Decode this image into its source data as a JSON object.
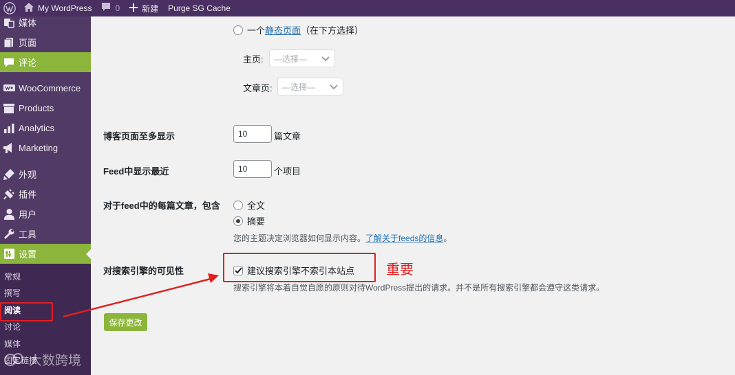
{
  "adminbar": {
    "site_name": "My WordPress",
    "comments_count": "0",
    "new_label": "新建",
    "purge_label": "Purge SG Cache"
  },
  "sidebar": {
    "items": [
      {
        "label": "媒体",
        "icon": "media-icon",
        "state": "normal"
      },
      {
        "label": "页面",
        "icon": "page-icon",
        "state": "normal"
      },
      {
        "label": "评论",
        "icon": "comment-icon",
        "state": "highlight"
      },
      {
        "label": "WooCommerce",
        "icon": "woo-icon",
        "state": "normal"
      },
      {
        "label": "Products",
        "icon": "products-icon",
        "state": "normal"
      },
      {
        "label": "Analytics",
        "icon": "analytics-icon",
        "state": "normal"
      },
      {
        "label": "Marketing",
        "icon": "marketing-icon",
        "state": "normal"
      },
      {
        "label": "外观",
        "icon": "appearance-icon",
        "state": "normal"
      },
      {
        "label": "插件",
        "icon": "plugins-icon",
        "state": "normal"
      },
      {
        "label": "用户",
        "icon": "users-icon",
        "state": "normal"
      },
      {
        "label": "工具",
        "icon": "tools-icon",
        "state": "normal"
      },
      {
        "label": "设置",
        "icon": "settings-icon",
        "state": "current"
      }
    ],
    "submenu": [
      "常规",
      "撰写",
      "阅读",
      "讨论",
      "媒体",
      "固定链接"
    ],
    "submenu_current": "阅读"
  },
  "content": {
    "static_page_option": {
      "prefix": "一个",
      "link": "静态页面",
      "suffix": "（在下方选择）"
    },
    "homepage_label": "主页:",
    "homepage_select": "—选择—",
    "postspage_label": "文章页:",
    "postspage_select": "—选择—",
    "posts_per_page": {
      "label": "博客页面至多显示",
      "value": "10",
      "unit": "篇文章"
    },
    "feed_recent": {
      "label": "Feed中显示最近",
      "value": "10",
      "unit": "个项目"
    },
    "feed_content": {
      "label": "对于feed中的每篇文章，包含",
      "options": [
        "全文",
        "摘要"
      ],
      "selected": "摘要",
      "desc": "您的主题决定浏览器如何显示内容。",
      "link": "了解关于feeds的信息",
      "period": "。"
    },
    "search_visibility": {
      "label": "对搜索引擎的可见性",
      "checkbox_label": "建议搜索引擎不索引本站点",
      "checked": true,
      "desc": "搜索引擎将本着自觉自愿的原则对待WordPress提出的请求。并不是所有搜索引擎都会遵守这类请求。"
    },
    "save_button": "保存更改"
  },
  "annotation": {
    "text": "重要",
    "color": "#e02020"
  },
  "watermark": "大数跨境",
  "colors": {
    "adminbar": "#4a2f63",
    "sidebar": "#523a66",
    "accent": "#8cb53c",
    "link": "#2271b1"
  }
}
